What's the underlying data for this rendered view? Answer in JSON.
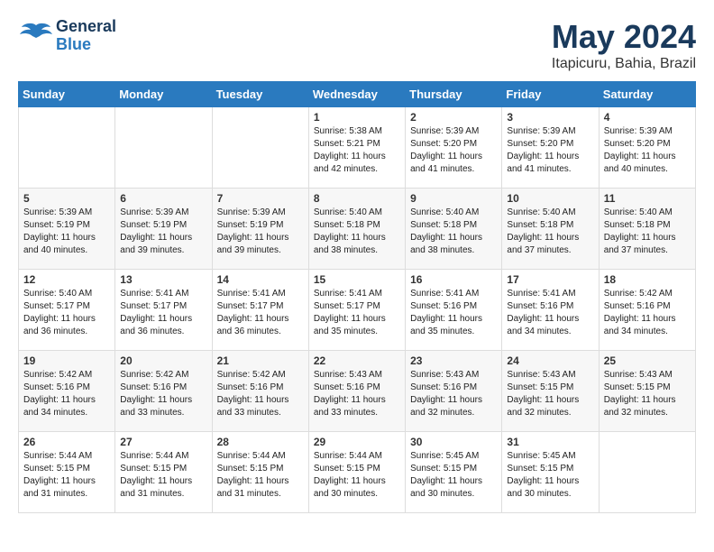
{
  "header": {
    "logo_general": "General",
    "logo_blue": "Blue",
    "title": "May 2024",
    "subtitle": "Itapicuru, Bahia, Brazil"
  },
  "days_of_week": [
    "Sunday",
    "Monday",
    "Tuesday",
    "Wednesday",
    "Thursday",
    "Friday",
    "Saturday"
  ],
  "weeks": [
    [
      {
        "day": "",
        "info": ""
      },
      {
        "day": "",
        "info": ""
      },
      {
        "day": "",
        "info": ""
      },
      {
        "day": "1",
        "info": "Sunrise: 5:38 AM\nSunset: 5:21 PM\nDaylight: 11 hours\nand 42 minutes."
      },
      {
        "day": "2",
        "info": "Sunrise: 5:39 AM\nSunset: 5:20 PM\nDaylight: 11 hours\nand 41 minutes."
      },
      {
        "day": "3",
        "info": "Sunrise: 5:39 AM\nSunset: 5:20 PM\nDaylight: 11 hours\nand 41 minutes."
      },
      {
        "day": "4",
        "info": "Sunrise: 5:39 AM\nSunset: 5:20 PM\nDaylight: 11 hours\nand 40 minutes."
      }
    ],
    [
      {
        "day": "5",
        "info": "Sunrise: 5:39 AM\nSunset: 5:19 PM\nDaylight: 11 hours\nand 40 minutes."
      },
      {
        "day": "6",
        "info": "Sunrise: 5:39 AM\nSunset: 5:19 PM\nDaylight: 11 hours\nand 39 minutes."
      },
      {
        "day": "7",
        "info": "Sunrise: 5:39 AM\nSunset: 5:19 PM\nDaylight: 11 hours\nand 39 minutes."
      },
      {
        "day": "8",
        "info": "Sunrise: 5:40 AM\nSunset: 5:18 PM\nDaylight: 11 hours\nand 38 minutes."
      },
      {
        "day": "9",
        "info": "Sunrise: 5:40 AM\nSunset: 5:18 PM\nDaylight: 11 hours\nand 38 minutes."
      },
      {
        "day": "10",
        "info": "Sunrise: 5:40 AM\nSunset: 5:18 PM\nDaylight: 11 hours\nand 37 minutes."
      },
      {
        "day": "11",
        "info": "Sunrise: 5:40 AM\nSunset: 5:18 PM\nDaylight: 11 hours\nand 37 minutes."
      }
    ],
    [
      {
        "day": "12",
        "info": "Sunrise: 5:40 AM\nSunset: 5:17 PM\nDaylight: 11 hours\nand 36 minutes."
      },
      {
        "day": "13",
        "info": "Sunrise: 5:41 AM\nSunset: 5:17 PM\nDaylight: 11 hours\nand 36 minutes."
      },
      {
        "day": "14",
        "info": "Sunrise: 5:41 AM\nSunset: 5:17 PM\nDaylight: 11 hours\nand 36 minutes."
      },
      {
        "day": "15",
        "info": "Sunrise: 5:41 AM\nSunset: 5:17 PM\nDaylight: 11 hours\nand 35 minutes."
      },
      {
        "day": "16",
        "info": "Sunrise: 5:41 AM\nSunset: 5:16 PM\nDaylight: 11 hours\nand 35 minutes."
      },
      {
        "day": "17",
        "info": "Sunrise: 5:41 AM\nSunset: 5:16 PM\nDaylight: 11 hours\nand 34 minutes."
      },
      {
        "day": "18",
        "info": "Sunrise: 5:42 AM\nSunset: 5:16 PM\nDaylight: 11 hours\nand 34 minutes."
      }
    ],
    [
      {
        "day": "19",
        "info": "Sunrise: 5:42 AM\nSunset: 5:16 PM\nDaylight: 11 hours\nand 34 minutes."
      },
      {
        "day": "20",
        "info": "Sunrise: 5:42 AM\nSunset: 5:16 PM\nDaylight: 11 hours\nand 33 minutes."
      },
      {
        "day": "21",
        "info": "Sunrise: 5:42 AM\nSunset: 5:16 PM\nDaylight: 11 hours\nand 33 minutes."
      },
      {
        "day": "22",
        "info": "Sunrise: 5:43 AM\nSunset: 5:16 PM\nDaylight: 11 hours\nand 33 minutes."
      },
      {
        "day": "23",
        "info": "Sunrise: 5:43 AM\nSunset: 5:16 PM\nDaylight: 11 hours\nand 32 minutes."
      },
      {
        "day": "24",
        "info": "Sunrise: 5:43 AM\nSunset: 5:15 PM\nDaylight: 11 hours\nand 32 minutes."
      },
      {
        "day": "25",
        "info": "Sunrise: 5:43 AM\nSunset: 5:15 PM\nDaylight: 11 hours\nand 32 minutes."
      }
    ],
    [
      {
        "day": "26",
        "info": "Sunrise: 5:44 AM\nSunset: 5:15 PM\nDaylight: 11 hours\nand 31 minutes."
      },
      {
        "day": "27",
        "info": "Sunrise: 5:44 AM\nSunset: 5:15 PM\nDaylight: 11 hours\nand 31 minutes."
      },
      {
        "day": "28",
        "info": "Sunrise: 5:44 AM\nSunset: 5:15 PM\nDaylight: 11 hours\nand 31 minutes."
      },
      {
        "day": "29",
        "info": "Sunrise: 5:44 AM\nSunset: 5:15 PM\nDaylight: 11 hours\nand 30 minutes."
      },
      {
        "day": "30",
        "info": "Sunrise: 5:45 AM\nSunset: 5:15 PM\nDaylight: 11 hours\nand 30 minutes."
      },
      {
        "day": "31",
        "info": "Sunrise: 5:45 AM\nSunset: 5:15 PM\nDaylight: 11 hours\nand 30 minutes."
      },
      {
        "day": "",
        "info": ""
      }
    ]
  ]
}
